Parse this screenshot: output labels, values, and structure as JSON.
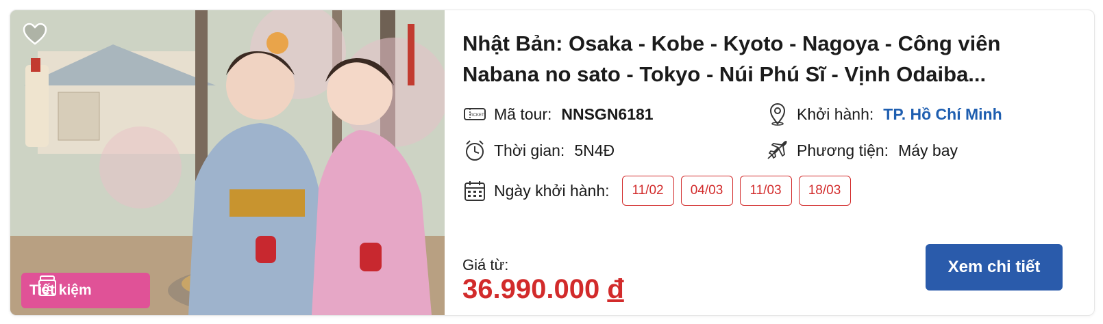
{
  "tour": {
    "title": "Nhật Bản: Osaka - Kobe - Kyoto - Nagoya - Công viên Nabana no sato - Tokyo - Núi Phú Sĩ - Vịnh Odaiba...",
    "badge_label": "Tiết kiệm",
    "code_label": "Mã tour:",
    "code_value": "NNSGN6181",
    "depart_label": "Khởi hành:",
    "depart_value": "TP. Hồ Chí Minh",
    "duration_label": "Thời gian:",
    "duration_value": "5N4Đ",
    "transport_label": "Phương tiện:",
    "transport_value": "Máy bay",
    "dates_label": "Ngày khởi hành:",
    "dates": [
      "11/02",
      "04/03",
      "11/03",
      "18/03"
    ],
    "price_label": "Giá từ:",
    "price_value": "36.990.000",
    "currency": "đ",
    "cta_label": "Xem chi tiết"
  },
  "icons": {
    "favorite": "heart-outline-icon",
    "badge": "piggy-jar-icon",
    "code": "ticket-icon",
    "depart": "map-pin-icon",
    "duration": "alarm-clock-icon",
    "transport": "airplane-icon",
    "dates": "calendar-icon"
  },
  "colors": {
    "accent_red": "#d22b2b",
    "brand_blue": "#2a5bab",
    "depart_blue": "#1e5eb0",
    "badge_pink": "#e05297"
  }
}
